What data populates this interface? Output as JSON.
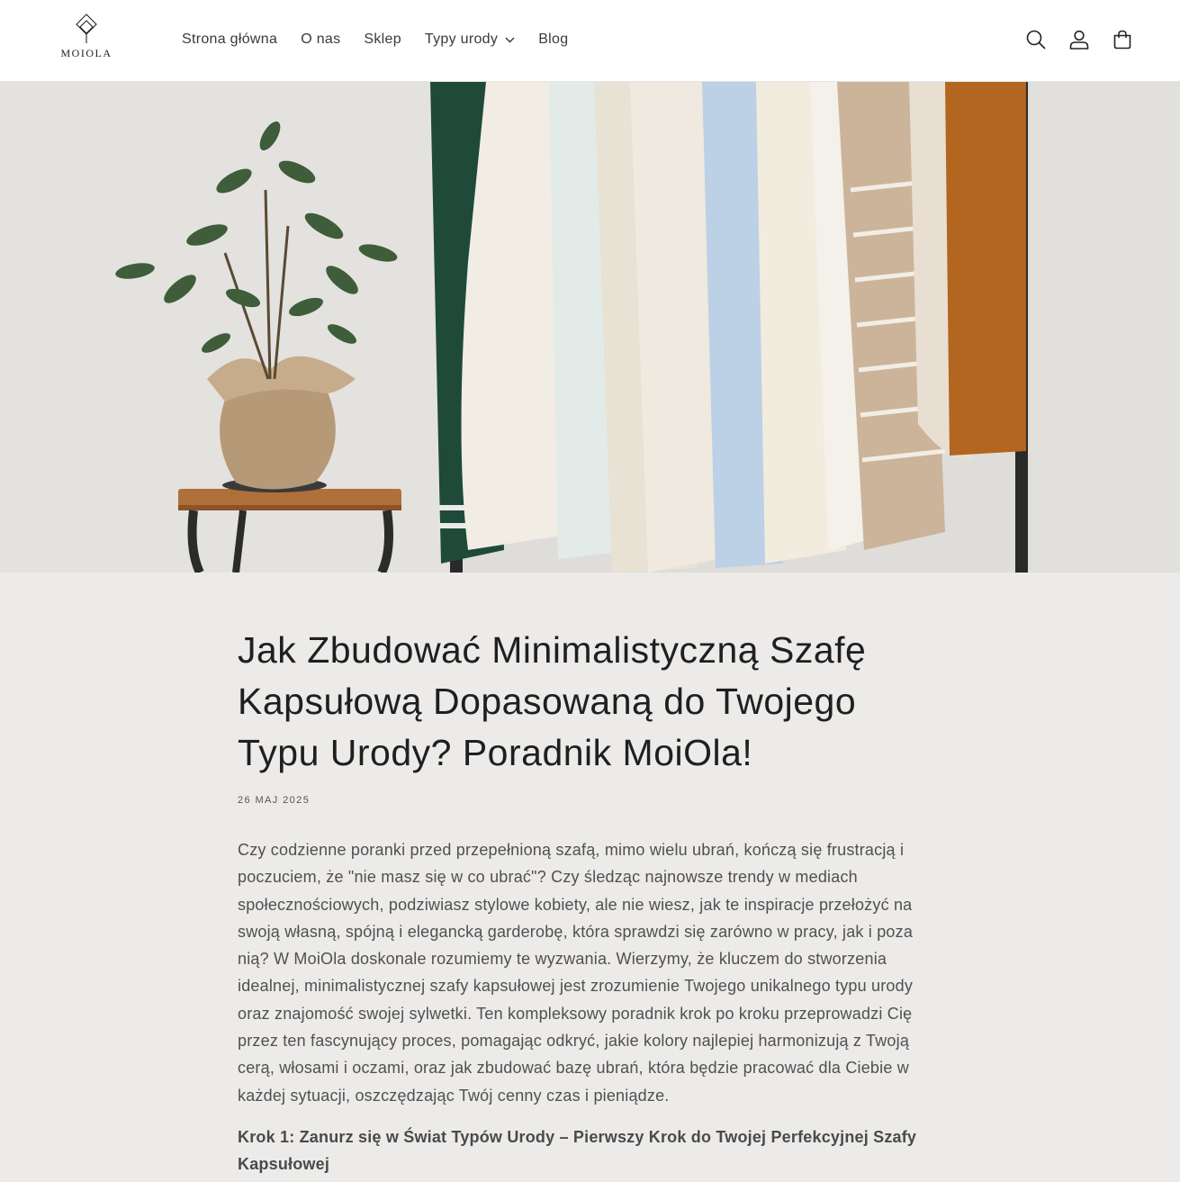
{
  "header": {
    "logo_text": "MOIOLA",
    "nav": [
      {
        "label": "Strona główna"
      },
      {
        "label": "O nas"
      },
      {
        "label": "Sklep"
      },
      {
        "label": "Typy urody"
      },
      {
        "label": "Blog"
      }
    ],
    "icons": [
      "search-icon",
      "account-icon",
      "cart-icon"
    ]
  },
  "article": {
    "title": "Jak Zbudować Minimalistyczną Szafę Kapsułową Dopasowaną do Twojego Typu Urody? Poradnik MoiOla!",
    "date": "26 MAJ 2025",
    "intro": "Czy codzienne poranki przed przepełnioną szafą, mimo wielu ubrań, kończą się frustracją i poczuciem, że \"nie masz się w co ubrać\"? Czy śledząc najnowsze trendy w mediach społecznościowych, podziwiasz stylowe kobiety, ale nie wiesz, jak te inspiracje przełożyć na swoją własną, spójną i elegancką garderobę, która sprawdzi się zarówno w pracy, jak i poza nią? W MoiOla doskonale rozumiemy te wyzwania. Wierzymy, że kluczem do stworzenia idealnej, minimalistycznej szafy kapsułowej jest zrozumienie Twojego unikalnego typu urody oraz znajomość swojej sylwetki. Ten kompleksowy poradnik krok po kroku przeprowadzi Cię przez ten fascynujący proces, pomagając odkryć, jakie kolory najlepiej harmonizują z Twoją cerą, włosami i oczami, oraz jak zbudować bazę ubrań, która będzie pracować dla Ciebie w każdej sytuacji, oszczędzając Twój cenny czas i pieniądze.",
    "step1_heading": "Krok 1: Zanurz się w Świat Typów Urody – Pierwszy Krok do Twojej Perfekcyjnej Szafy Kapsułowej"
  },
  "colors": {
    "background": "#ecebe9",
    "header_bg": "#ffffff",
    "text": "#222222"
  }
}
